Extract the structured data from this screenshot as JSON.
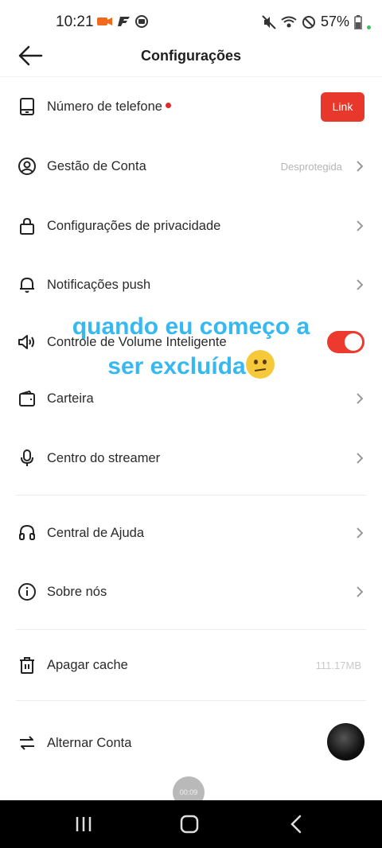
{
  "status_bar": {
    "time": "10:21",
    "battery": "57%"
  },
  "header": {
    "title": "Configurações"
  },
  "rows": [
    {
      "label": "Número de telefone",
      "button": "Link"
    },
    {
      "label": "Gestão de Conta",
      "value": "Desprotegida"
    },
    {
      "label": "Configurações de privacidade"
    },
    {
      "label": "Notificações push"
    },
    {
      "label": "Controle de Volume Inteligente",
      "toggle_on": true
    },
    {
      "label": "Carteira"
    },
    {
      "label": "Centro do streamer"
    },
    {
      "label": "Central de Ajuda"
    },
    {
      "label": "Sobre nós"
    },
    {
      "label": "Apagar cache",
      "value": "111.17MB"
    },
    {
      "label": "Alternar Conta"
    }
  ],
  "overlay_text": {
    "line1": "quando eu começo a",
    "line2": "ser excluída"
  },
  "video_timer": "00:09",
  "colors": {
    "accent": "#e8382b",
    "overlay": "#36b8f0"
  }
}
